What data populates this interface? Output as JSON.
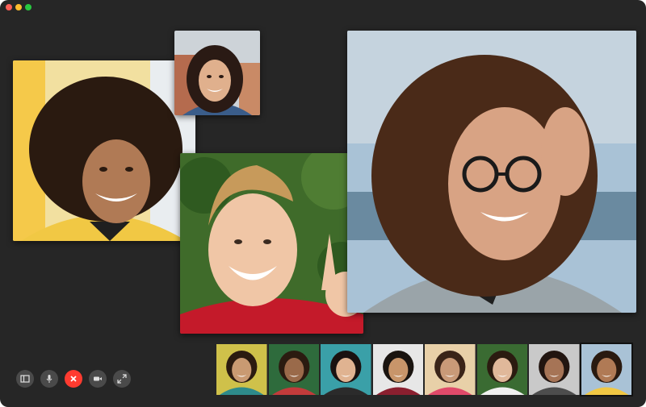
{
  "window": {
    "traffic_lights": {
      "close": "#fc5f57",
      "minimize": "#fdbc2e",
      "zoom": "#28c840"
    }
  },
  "tiles": [
    {
      "id": "curly-hair-woman",
      "bg": "#f2e0a0",
      "shirt": "#f1c844",
      "skin": "#b07a55",
      "hair": "#2a1a10"
    },
    {
      "id": "brunette-woman-small",
      "bg": "#cdd3d8",
      "shirt": "#3a5d8a",
      "skin": "#e0b08d",
      "hair": "#2a1a14"
    },
    {
      "id": "blond-man-waving",
      "bg": "#3f6b2a",
      "shirt": "#c41a2a",
      "skin": "#f0c6a6",
      "hair": "#c79a5b"
    },
    {
      "id": "woman-with-glasses",
      "bg": "#a9c2d6",
      "shirt": "#9aa4a9",
      "skin": "#d8a384",
      "hair": "#4a2a18"
    }
  ],
  "controls": [
    {
      "name": "sidebar-toggle",
      "icon": "sidebar-icon"
    },
    {
      "name": "mute",
      "icon": "microphone-icon"
    },
    {
      "name": "end-call",
      "icon": "close-icon",
      "color": "#ff3b30"
    },
    {
      "name": "camera-toggle",
      "icon": "video-camera-icon"
    },
    {
      "name": "fullscreen",
      "icon": "expand-icon"
    }
  ],
  "participants_strip": [
    {
      "bg": "#cfc14a",
      "skin": "#c99a72",
      "hair": "#2b1b10",
      "shirt": "#2e8b8b"
    },
    {
      "bg": "#2e6b3c",
      "skin": "#9a6a4a",
      "hair": "#2b1b10",
      "shirt": "#c23b3b"
    },
    {
      "bg": "#3aa0a8",
      "skin": "#e0b391",
      "hair": "#1a1210",
      "shirt": "#2b2b2b"
    },
    {
      "bg": "#e7e7e7",
      "skin": "#c8956a",
      "hair": "#1a1410",
      "shirt": "#8a1f2f"
    },
    {
      "bg": "#e8d0a8",
      "skin": "#c99a78",
      "hair": "#3a2418",
      "shirt": "#e04a6a"
    },
    {
      "bg": "#3a6b32",
      "skin": "#e0b89a",
      "hair": "#2b1b10",
      "shirt": "#f0f0f0"
    },
    {
      "bg": "#c9c9c9",
      "skin": "#a67456",
      "hair": "#221510",
      "shirt": "#4d4d4d"
    },
    {
      "bg": "#a9c2d6",
      "skin": "#b07a55",
      "hair": "#2a1a10",
      "shirt": "#f1c844",
      "active": true
    }
  ]
}
